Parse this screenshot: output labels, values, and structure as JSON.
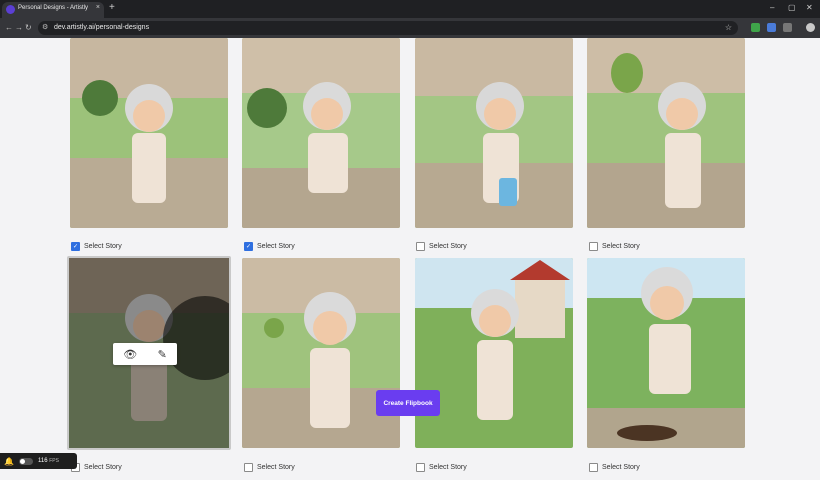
{
  "browser": {
    "tab_title": "Personal Designs - Artistly",
    "url": "dev.artistly.ai/personal-designs",
    "new_tab_label": "+",
    "tab_close": "×"
  },
  "icons": {
    "back": "←",
    "forward": "→",
    "reload": "↻",
    "site_info": "⚙",
    "star": "☆",
    "minimize": "–",
    "maximize": "▢",
    "close": "✕",
    "preview": "👁",
    "edit": "✎",
    "notification": "🔔"
  },
  "colors": {
    "accent": "#6a3df0",
    "checkbox_on": "#2f6fe0"
  },
  "gallery": {
    "checkbox_label": "Select Story",
    "items": [
      {
        "checked": true
      },
      {
        "checked": true
      },
      {
        "checked": false
      },
      {
        "checked": false
      },
      {
        "checked": false
      },
      {
        "checked": false
      },
      {
        "checked": false
      },
      {
        "checked": false
      }
    ]
  },
  "actions": {
    "create_flipbook": "Create Flipbook"
  },
  "status": {
    "fps_value": "116",
    "fps_unit": "FPS"
  }
}
